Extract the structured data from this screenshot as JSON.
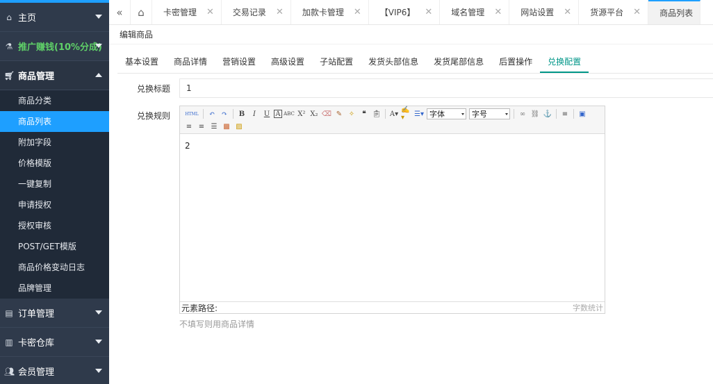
{
  "sidebar": {
    "home": "主页",
    "promo": "推广赚钱(10%分成)",
    "goods_group": "商品管理",
    "goods_items": [
      "商品分类",
      "商品列表",
      "附加字段",
      "价格模版",
      "一键复制",
      "申请授权",
      "授权审核",
      "POST/GET模版",
      "商品价格变动日志",
      "品牌管理"
    ],
    "order_group": "订单管理",
    "card_group": "卡密仓库",
    "member_group": "会员管理"
  },
  "tabs": [
    "卡密管理",
    "交易记录",
    "加款卡管理",
    "【VIP6】",
    "域名管理",
    "网站设置",
    "货源平台",
    "商品列表"
  ],
  "breadcrumb": "编辑商品",
  "subtabs": [
    "基本设置",
    "商品详情",
    "营销设置",
    "高级设置",
    "子站配置",
    "发货头部信息",
    "发货尾部信息",
    "后置操作",
    "兑换配置"
  ],
  "form": {
    "title_label": "兑换标题",
    "title_value": "1",
    "rule_label": "兑换规则",
    "editor_content": "2",
    "font_select": "字体",
    "size_select": "字号",
    "path_label": "元素路径:",
    "wordcount_label": "字数统计",
    "hint": "不填写则用商品详情"
  },
  "colors": {
    "sidebar_bg": "#2f3a4b",
    "sidebar_sub_bg": "#202a38",
    "accent": "#1e9fff",
    "tab_active": "#009688",
    "promo": "#5fd068"
  }
}
